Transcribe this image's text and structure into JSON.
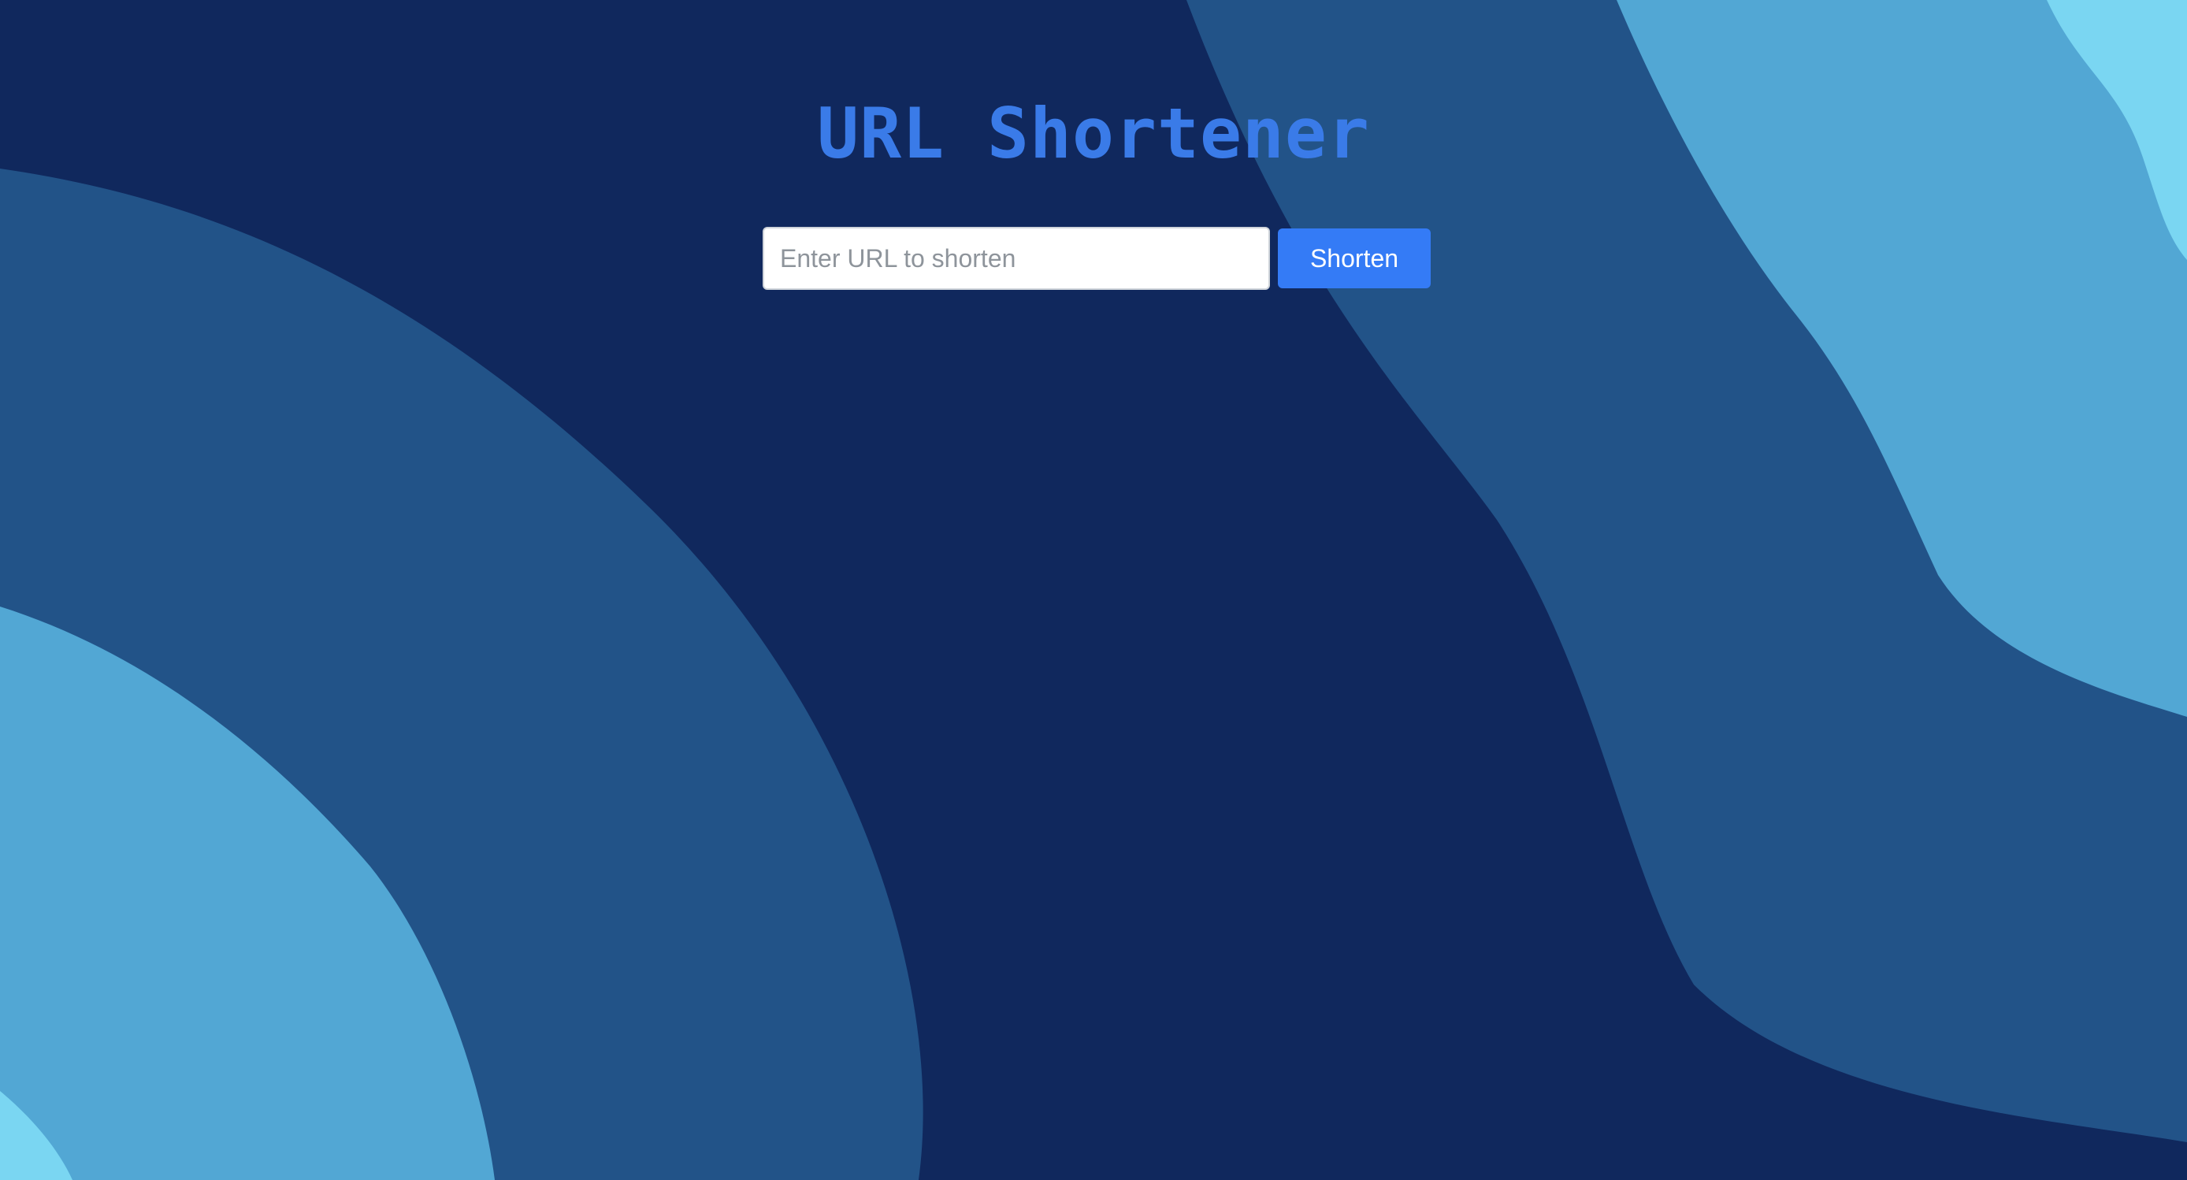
{
  "header": {
    "title": "URL Shortener"
  },
  "form": {
    "url_placeholder": "Enter URL to shorten",
    "url_value": "",
    "submit_label": "Shorten"
  },
  "colors": {
    "background_navy": "#10285d",
    "wave_mid_blue": "#225388",
    "wave_light_blue": "#52a7d4",
    "wave_sky_blue": "#7ad6f2",
    "title_blue": "#3a7be8",
    "button_blue": "#347bf6"
  }
}
